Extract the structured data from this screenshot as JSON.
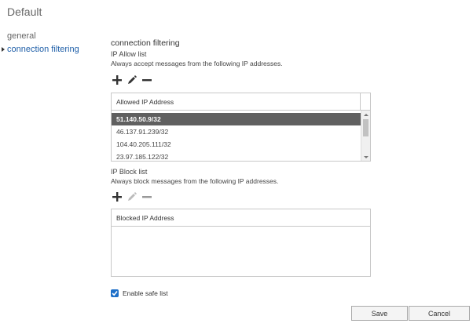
{
  "title": "Default",
  "nav": {
    "items": [
      {
        "label": "general"
      },
      {
        "label": "connection filtering"
      }
    ],
    "active_index": 1
  },
  "section": {
    "title": "connection filtering",
    "allow": {
      "label": "IP Allow list",
      "description": "Always accept messages from the following IP addresses.",
      "toolbar": {
        "add_icon": "plus-icon",
        "edit_icon": "pencil-icon",
        "remove_icon": "minus-icon"
      },
      "column_header": "Allowed IP Address",
      "rows": [
        "51.140.50.9/32",
        "46.137.91.239/32",
        "104.40.205.111/32",
        "23.97.185.122/32"
      ],
      "selected_index": 0
    },
    "block": {
      "label": "IP Block list",
      "description": "Always block messages from the following IP addresses.",
      "toolbar": {
        "add_icon": "plus-icon",
        "edit_icon": "pencil-icon",
        "remove_icon": "minus-icon"
      },
      "column_header": "Blocked IP Address",
      "rows": []
    }
  },
  "safe_list": {
    "label": "Enable safe list",
    "checked": true
  },
  "buttons": {
    "save": "Save",
    "cancel": "Cancel"
  },
  "colors": {
    "accent": "#1f5fa8",
    "selected_row": "#606060",
    "checkbox": "#1d6fc8"
  }
}
